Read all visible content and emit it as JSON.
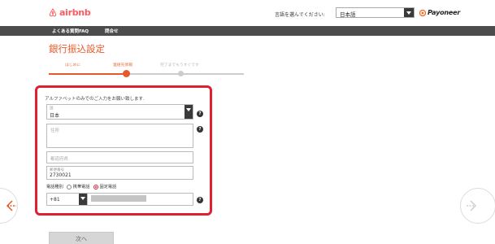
{
  "header": {
    "logo_text": "airbnb",
    "language_label": "言語を選んでください:",
    "language_value": "日本語",
    "partner_logo": "Payoneer"
  },
  "nav": {
    "items": [
      "よくある質問FAQ",
      "問合せ"
    ]
  },
  "page": {
    "title": "銀行振込設定"
  },
  "stepper": {
    "steps": [
      "はじめに",
      "連絡先情報",
      "完了までもうすぐです"
    ],
    "current_step": 2
  },
  "form": {
    "instruction": "アルファベットのみでのご入力をお願い致します.",
    "country": {
      "label": "国",
      "value": "日本"
    },
    "address": {
      "placeholder": "住所"
    },
    "prefecture": {
      "placeholder": "都道府県"
    },
    "postal": {
      "label": "郵便番号",
      "value": "2730021"
    },
    "phone_type": {
      "label": "電話種別",
      "options": [
        "携帯電話",
        "固定電話"
      ],
      "selected": "固定電話"
    },
    "phone": {
      "country_code": "+81"
    },
    "help_glyph": "?"
  },
  "actions": {
    "next_label": "次へ"
  },
  "colors": {
    "accent": "#e55a2b",
    "highlight": "#e0202e",
    "brand": "#ff5a5f",
    "nav_bg": "#4c4c4c",
    "step_inactive": "#cccccc"
  },
  "icons": [
    "airbnb-logo-icon",
    "payoneer-logo-icon",
    "chevron-down-icon",
    "help-icon",
    "arrow-left-icon",
    "arrow-right-icon"
  ]
}
